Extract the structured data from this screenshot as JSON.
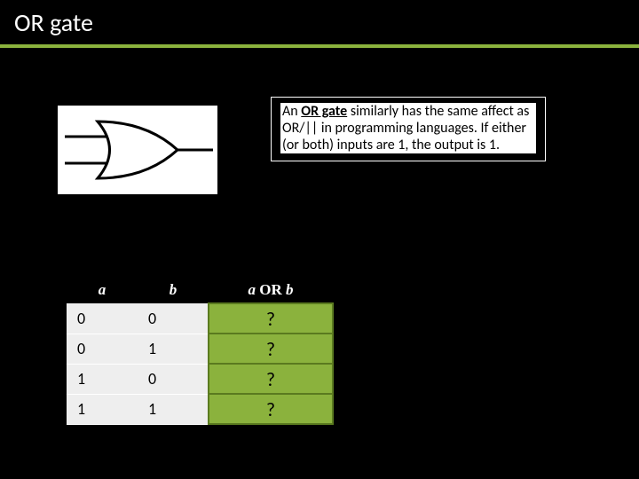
{
  "title": "OR gate",
  "description": {
    "prefix": "An ",
    "term": "OR gate",
    "body": " similarly has the same affect as OR/|| in programming languages. If either (or both) inputs are 1, the output is 1."
  },
  "table": {
    "headers": {
      "a": "a",
      "b": "b",
      "result": "a OR b"
    },
    "rows": [
      {
        "a": "0",
        "b": "0",
        "r": "?"
      },
      {
        "a": "0",
        "b": "1",
        "r": "?"
      },
      {
        "a": "1",
        "b": "0",
        "r": "?"
      },
      {
        "a": "1",
        "b": "1",
        "r": "?"
      }
    ]
  },
  "chart_data": {
    "type": "table",
    "title": "OR gate truth table",
    "columns": [
      "a",
      "b",
      "a OR b"
    ],
    "rows": [
      [
        "0",
        "0",
        "?"
      ],
      [
        "0",
        "1",
        "?"
      ],
      [
        "1",
        "0",
        "?"
      ],
      [
        "1",
        "1",
        "?"
      ]
    ]
  }
}
